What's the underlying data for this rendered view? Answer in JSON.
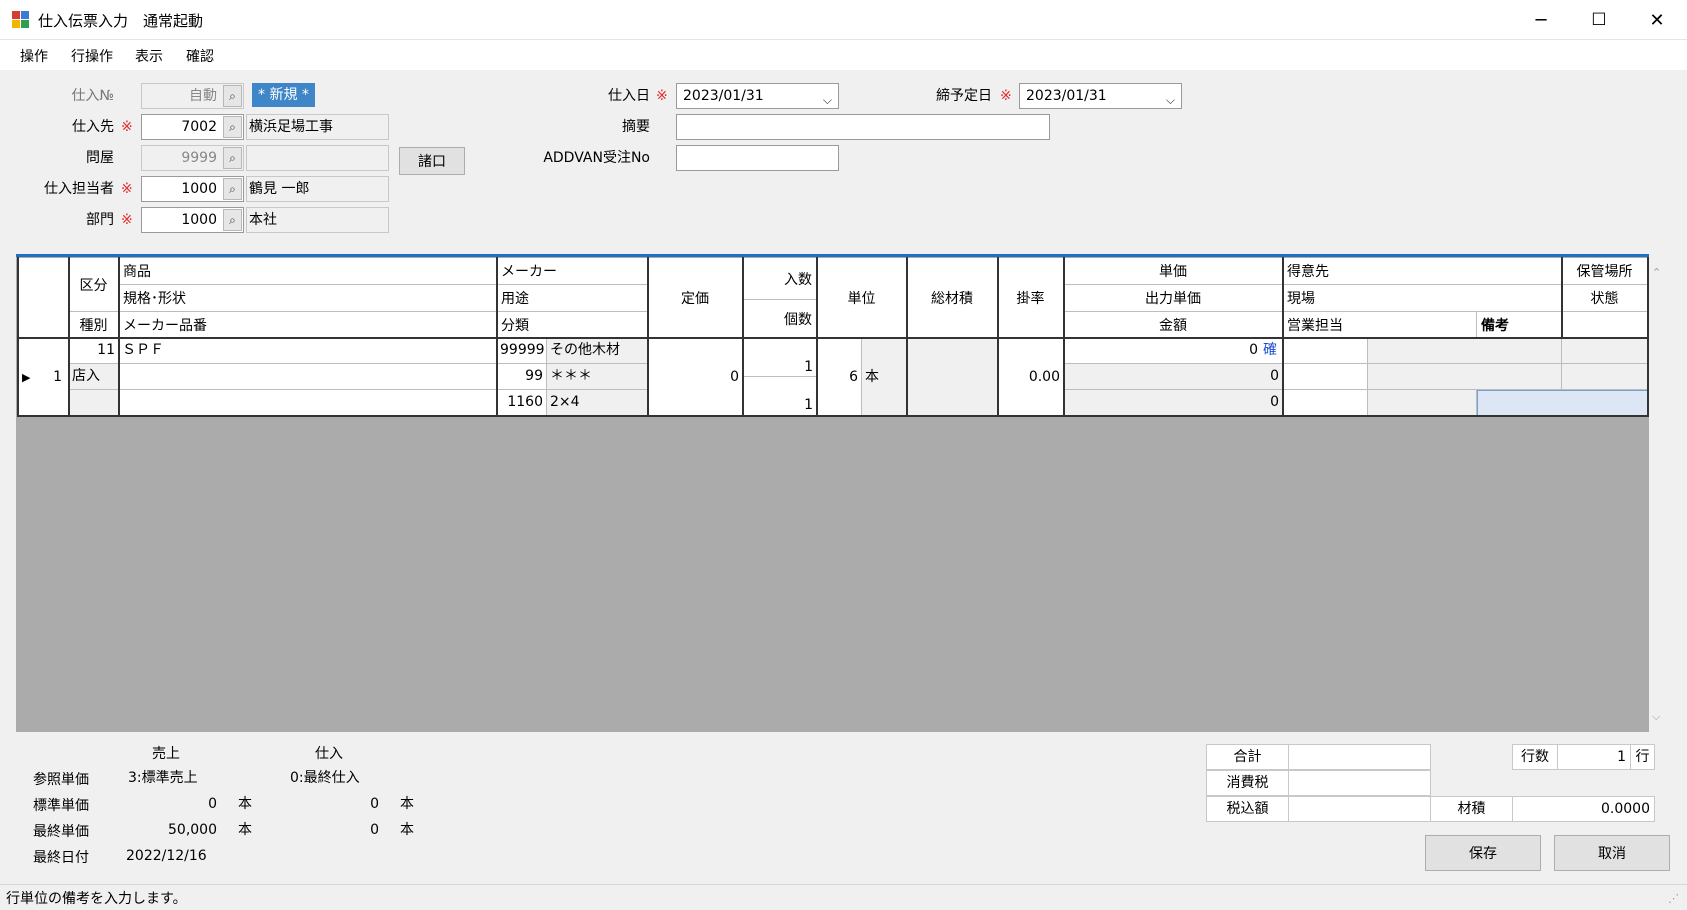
{
  "window": {
    "title": "仕入伝票入力　通常起動",
    "minimize": "─",
    "maximize": "☐",
    "close": "✕"
  },
  "menu": [
    "操作",
    "行操作",
    "表示",
    "確認"
  ],
  "form": {
    "shiire_no_label": "仕入№",
    "shiire_no_value": "自動",
    "new_badge": "* 新規 *",
    "shiiresaki_label": "仕入先",
    "shiiresaki_code": "7002",
    "shiiresaki_name": "横浜足場工事",
    "tonya_label": "問屋",
    "tonya_code": "9999",
    "tonya_name": "",
    "shokuchi_button": "諸口",
    "tantou_label": "仕入担当者",
    "tantou_code": "1000",
    "tantou_name": "鶴見 一郎",
    "bumon_label": "部門",
    "bumon_code": "1000",
    "bumon_name": "本社",
    "required_mark": "※",
    "shiire_date_label": "仕入日",
    "shiire_date_value": "2023/01/31",
    "shime_date_label": "締予定日",
    "shime_date_value": "2023/01/31",
    "tekiyou_label": "摘要",
    "tekiyou_value": "",
    "addvan_label": "ADDVAN受注No",
    "addvan_value": ""
  },
  "grid": {
    "headers": {
      "kubun": "区分",
      "shubetsu": "種別",
      "shouhin": "商品",
      "kikaku": "規格･形状",
      "maker_hinban": "メーカー品番",
      "maker": "メーカー",
      "youto": "用途",
      "bunrui": "分類",
      "teika": "定価",
      "irisu": "入数",
      "kosu": "個数",
      "tani": "単位",
      "souzaiseki": "総材積",
      "kakeritsu": "掛率",
      "tanka": "単価",
      "shutsuryoku_tanka": "出力単価",
      "kingaku": "金額",
      "tokuisaki": "得意先",
      "genba": "現場",
      "eigyou_tantou": "営業担当",
      "bikou": "備考",
      "hokan_basho": "保管場所",
      "joutai": "状態"
    },
    "rows": [
      {
        "row_no": "1",
        "kubun_code": "11",
        "kubun_name": "店入",
        "shouhin": "ＳＰＦ",
        "kikaku": "",
        "maker_hinban": "",
        "maker_code": "99999",
        "maker_name": "その他木材",
        "youto_code": "99",
        "youto_name": "＊＊＊",
        "bunrui_code": "1160",
        "bunrui_name": "2×4",
        "teika": "0",
        "irisu": "1",
        "kosu": "1",
        "tani_num": "6",
        "tani_name": "本",
        "kakeritsu": "0.00",
        "tanka": "0",
        "tanka_flag": "確",
        "shutsuryoku_tanka": "0",
        "kingaku": "0"
      }
    ]
  },
  "reference": {
    "col_uriage": "売上",
    "col_shiire": "仕入",
    "sanshou_label": "参照単価",
    "sanshou_uriage": "3:標準売上",
    "sanshou_shiire": "0:最終仕入",
    "hyoujun_label": "標準単価",
    "hyoujun_uriage": "0",
    "hyoujun_shiire": "0",
    "saishuu_label": "最終単価",
    "saishuu_uriage": "50,000",
    "saishuu_shiire": "0",
    "unit": "本",
    "saishuu_date_label": "最終日付",
    "saishuu_date_uriage": "2022/12/16",
    "saishuu_date_shiire": ""
  },
  "totals": {
    "goukei_label": "合計",
    "goukei_value": "",
    "shouhizei_label": "消費税",
    "shouhizei_value": "",
    "zeikomi_label": "税込額",
    "zeikomi_value": "",
    "gyousuu_label": "行数",
    "gyousuu_value": "1",
    "gyousuu_unit": "行",
    "zaiseki_label": "材積",
    "zaiseki_value": "0.0000"
  },
  "buttons": {
    "save": "保存",
    "cancel": "取消"
  },
  "status": {
    "message": "行単位の備考を入力します。"
  }
}
